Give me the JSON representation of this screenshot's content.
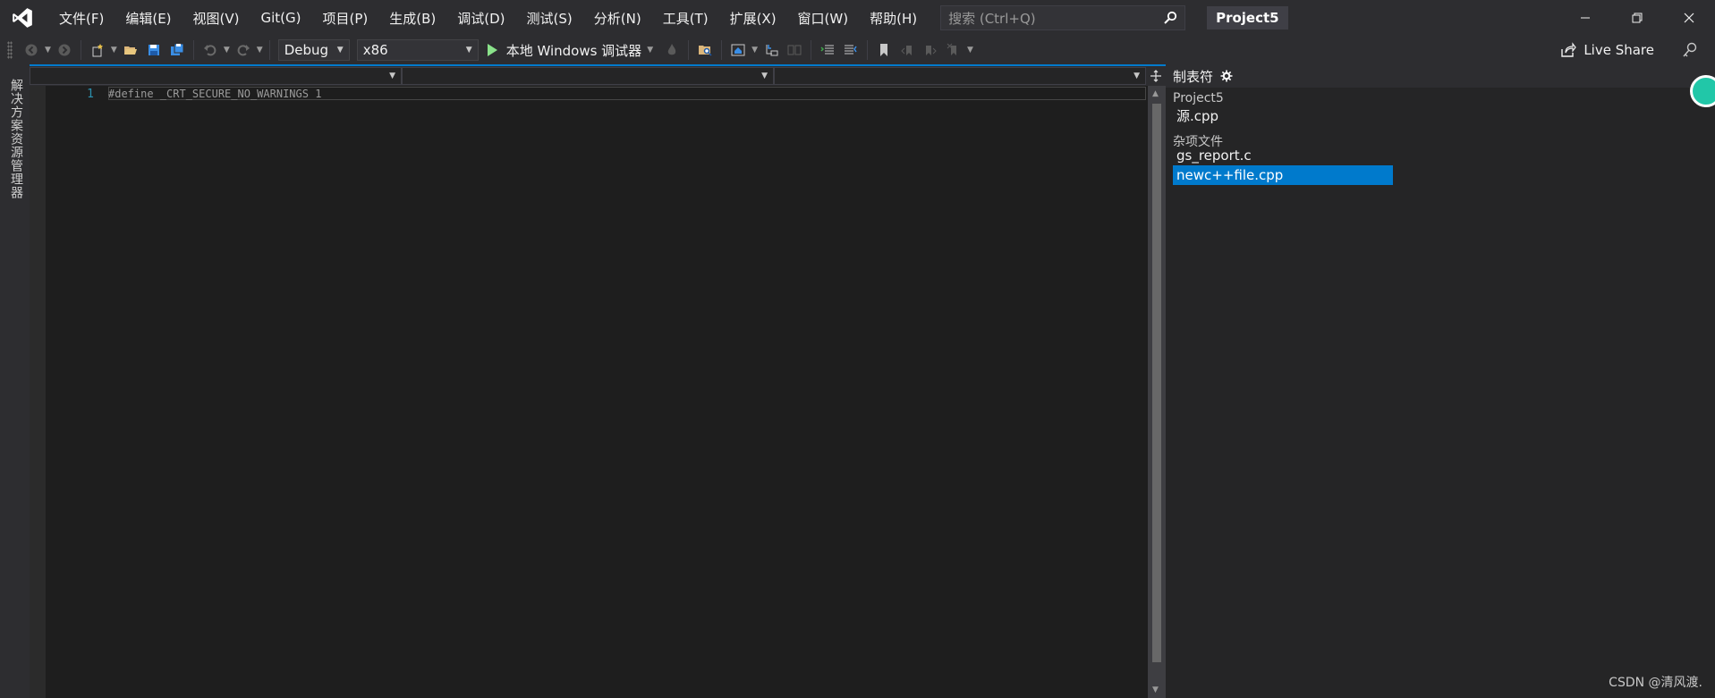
{
  "menu": {
    "items": [
      "文件(F)",
      "编辑(E)",
      "视图(V)",
      "Git(G)",
      "项目(P)",
      "生成(B)",
      "调试(D)",
      "测试(S)",
      "分析(N)",
      "工具(T)",
      "扩展(X)",
      "窗口(W)",
      "帮助(H)"
    ]
  },
  "search": {
    "placeholder": "搜索 (Ctrl+Q)"
  },
  "project_name": "Project5",
  "toolbar": {
    "config": "Debug",
    "platform": "x86",
    "run_label": "本地 Windows 调试器",
    "liveshare_label": "Live Share"
  },
  "left_tab": {
    "label": "解决方案资源管理器"
  },
  "editor": {
    "line_number": "1",
    "code": "#define _CRT_SECURE_NO_WARNINGS 1"
  },
  "right_panel": {
    "title": "制表符",
    "group1_label": "Project5",
    "group1_files": [
      "源.cpp"
    ],
    "group2_label": "杂项文件",
    "group2_files": [
      "gs_report.c",
      "newc++file.cpp"
    ],
    "selected_file": "newc++file.cpp"
  },
  "watermark": "CSDN @清风渡.",
  "colors": {
    "accent": "#007acc",
    "background": "#1e1e1e",
    "chrome": "#2d2d30"
  }
}
